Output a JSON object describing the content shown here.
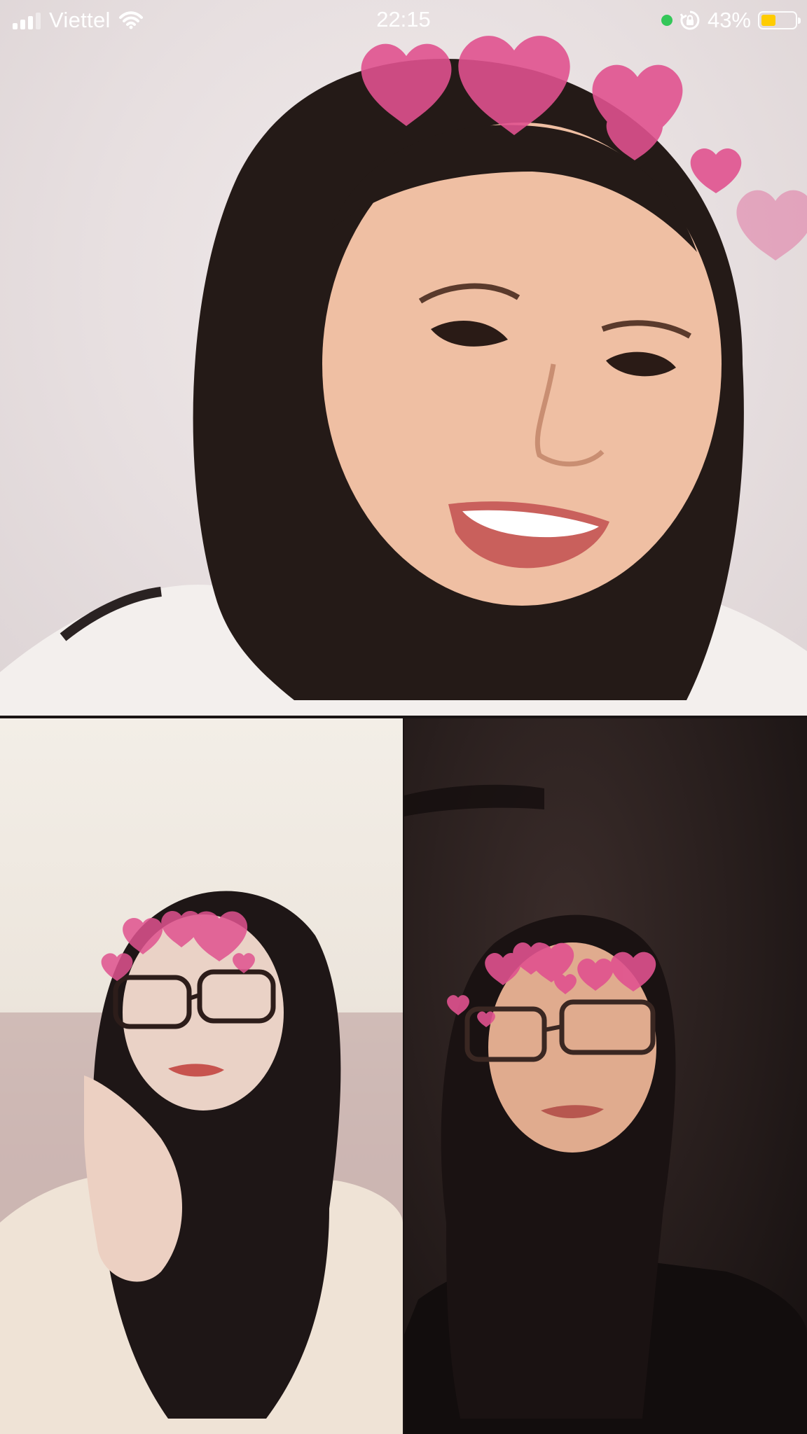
{
  "status_bar": {
    "carrier": "Viettel",
    "time": "22:15",
    "battery_percent": "43%",
    "battery_level": 0.43,
    "icons": [
      "signal-icon",
      "wifi-icon",
      "camera-in-use-dot",
      "orientation-lock-icon",
      "battery-icon"
    ],
    "colors": {
      "camera_dot": "#34c759",
      "battery_fill": "#ffcc00"
    }
  },
  "call": {
    "participants": [
      {
        "tile": "top",
        "effect": "heart-crown-filter"
      },
      {
        "tile": "bottom-left",
        "effect": "heart-crown-filter"
      },
      {
        "tile": "bottom-right",
        "effect": "heart-crown-filter"
      }
    ],
    "heart_color": "#e0528f"
  }
}
